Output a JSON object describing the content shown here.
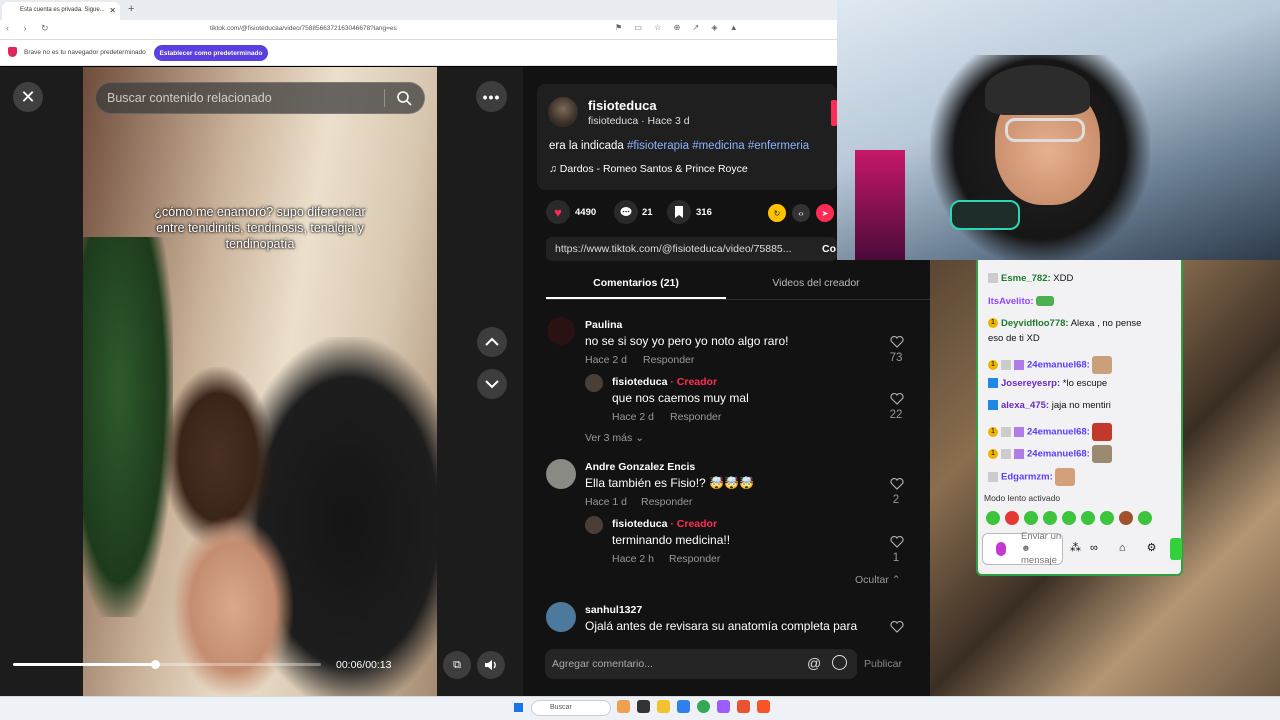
{
  "browser": {
    "tab_title": "Esta cuenta es privada. Sigue...",
    "url": "tiktok.com/@fisioteducaa/video/7588566372163046678?lang=es",
    "info_text": "Brave no es tu navegador predeterminado",
    "set_default_label": "Establecer como predeterminado",
    "new_tab": "+",
    "close_tab": "✕",
    "window_controls": "—   ❐   ✕",
    "nav_glyphs": "‹ › ↻",
    "addr_icons": "⚑ ▭ ☆ ⊕ ↗ ◈ ▲"
  },
  "video": {
    "search_placeholder": "Buscar contenido relacionado",
    "caption": "¿cómo me enamoró? supo diferenciar entre tenidinitis, tendinosis, tenalgia y tendinopatía",
    "time": "00:06/00:13",
    "progress": 0.46,
    "close_glyph": "✕",
    "more_glyph": "•••"
  },
  "post": {
    "author": "fisioteduca",
    "author_sub": "fisioteduca · Hace 3 d",
    "description_text": "era la indicada ",
    "hashtags": "#fisioterapia #medicina #enfermeria",
    "music": "♫  Dardos - Romeo Santos & Prince Royce",
    "likes": "4490",
    "comments": "21",
    "saves": "316",
    "link": "https://www.tiktok.com/@fisioteduca/video/75885...",
    "copy_label": "Co"
  },
  "tabs": {
    "comments": "Comentarios (21)",
    "creator_videos": "Videos del creador"
  },
  "comments": [
    {
      "name": "Paulina",
      "text": "no se si soy yo pero yo noto algo raro!",
      "time": "Hace 2 d",
      "reply": "Responder",
      "likes": "73"
    },
    {
      "name": "fisioteduca",
      "creator": "· Creador",
      "text": "que nos caemos muy mal",
      "time": "Hace 2 d",
      "reply": "Responder",
      "likes": "22"
    },
    {
      "name": "Andre Gonzalez Encis",
      "text": "Ella también es Fisio!? 🤯🤯🤯",
      "time": "Hace 1 d",
      "reply": "Responder",
      "likes": "2"
    },
    {
      "name": "fisioteduca",
      "creator": "· Creador",
      "text": "terminando medicina!!",
      "time": "Hace 2 h",
      "reply": "Responder",
      "likes": "1"
    },
    {
      "name": "sanhul1327",
      "text": "Ojalá antes de revisara su anatomía completa para",
      "time": "",
      "reply": "",
      "likes": ""
    }
  ],
  "ver_mas": "Ver 3 más ⌄",
  "ocultar": "Ocultar ⌃",
  "add_comment_placeholder": "Agregar comentario...",
  "at_glyph": "@",
  "publish_label": "Publicar",
  "chat": {
    "lines": [
      {
        "user": "Esme_782:",
        "msg": " XDD"
      },
      {
        "user": "ItsAvelito:",
        "msg": ""
      },
      {
        "user": "Deyvidfloo778:",
        "msg": " Alexa , no pense"
      },
      {
        "user": "",
        "msg": "eso de ti XD"
      },
      {
        "user": "24emanuel68:",
        "msg": ""
      },
      {
        "user": "Josereyesrp:",
        "msg": " *lo escupe"
      },
      {
        "user": "alexa_475:",
        "msg": " jaja no mentiri"
      },
      {
        "user": "24emanuel68:",
        "msg": ""
      },
      {
        "user": "24emanuel68:",
        "msg": ""
      },
      {
        "user": "Edgarmzm:",
        "msg": ""
      }
    ],
    "slow_mode": "Modo lento activado",
    "input_placeholder": "Enviar un ☻ mensaje",
    "buttons": "⁂∞ ⌂ ⚙",
    "badge_glyph": "1"
  },
  "taskbar": {
    "search": "Buscar"
  }
}
